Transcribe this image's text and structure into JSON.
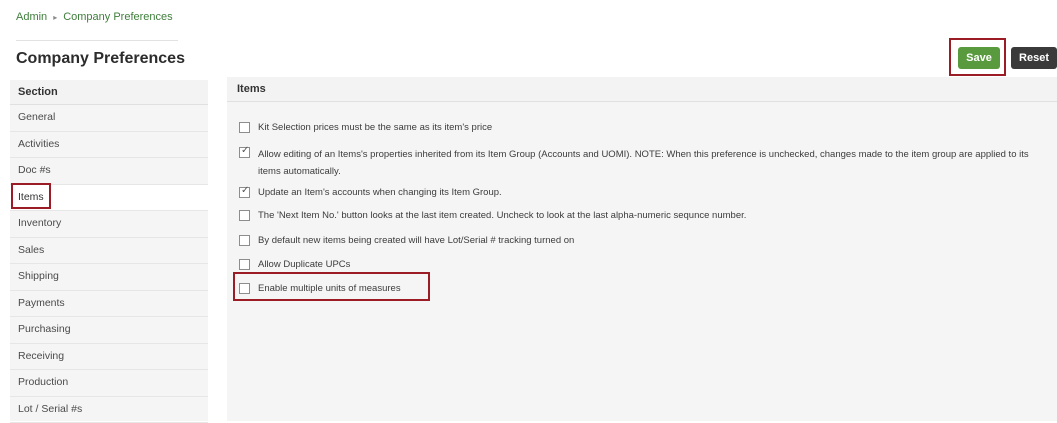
{
  "breadcrumb": {
    "root": "Admin",
    "separator": "▸",
    "current": "Company Preferences"
  },
  "page_title": "Company Preferences",
  "toolbar": {
    "save_label": "Save",
    "reset_label": "Reset"
  },
  "sidebar": {
    "header": "Section",
    "items": [
      {
        "label": "General"
      },
      {
        "label": "Activities"
      },
      {
        "label": "Doc #s"
      },
      {
        "label": "Items",
        "active": true
      },
      {
        "label": "Inventory"
      },
      {
        "label": "Sales"
      },
      {
        "label": "Shipping"
      },
      {
        "label": "Payments"
      },
      {
        "label": "Purchasing"
      },
      {
        "label": "Receiving"
      },
      {
        "label": "Production"
      },
      {
        "label": "Lot / Serial #s"
      }
    ]
  },
  "panel": {
    "header": "Items",
    "options": [
      {
        "label": "Kit Selection prices must be the same as its item's price",
        "checked": false
      },
      {
        "label": "Allow editing of an Items's properties inherited from its Item Group (Accounts and UOMI). NOTE: When this preference is unchecked, changes made to the item group are applied to its items automatically.",
        "checked": true
      },
      {
        "label": "Update an Item's accounts when changing its Item Group.",
        "checked": true
      },
      {
        "label": "The 'Next Item No.' button looks at the last item created. Uncheck to look at the last alpha-numeric sequnce number.",
        "checked": false
      },
      {
        "label": "By default new items being created will have Lot/Serial # tracking turned on",
        "checked": false
      },
      {
        "label": "Allow Duplicate UPCs",
        "checked": false
      },
      {
        "label": "Enable multiple units of measures",
        "checked": false
      }
    ]
  },
  "colors": {
    "save_button": "#5a9a3f",
    "reset_button": "#3a3a3a",
    "highlight_box": "#9c1c26",
    "breadcrumb_link": "#3f7e3b"
  }
}
